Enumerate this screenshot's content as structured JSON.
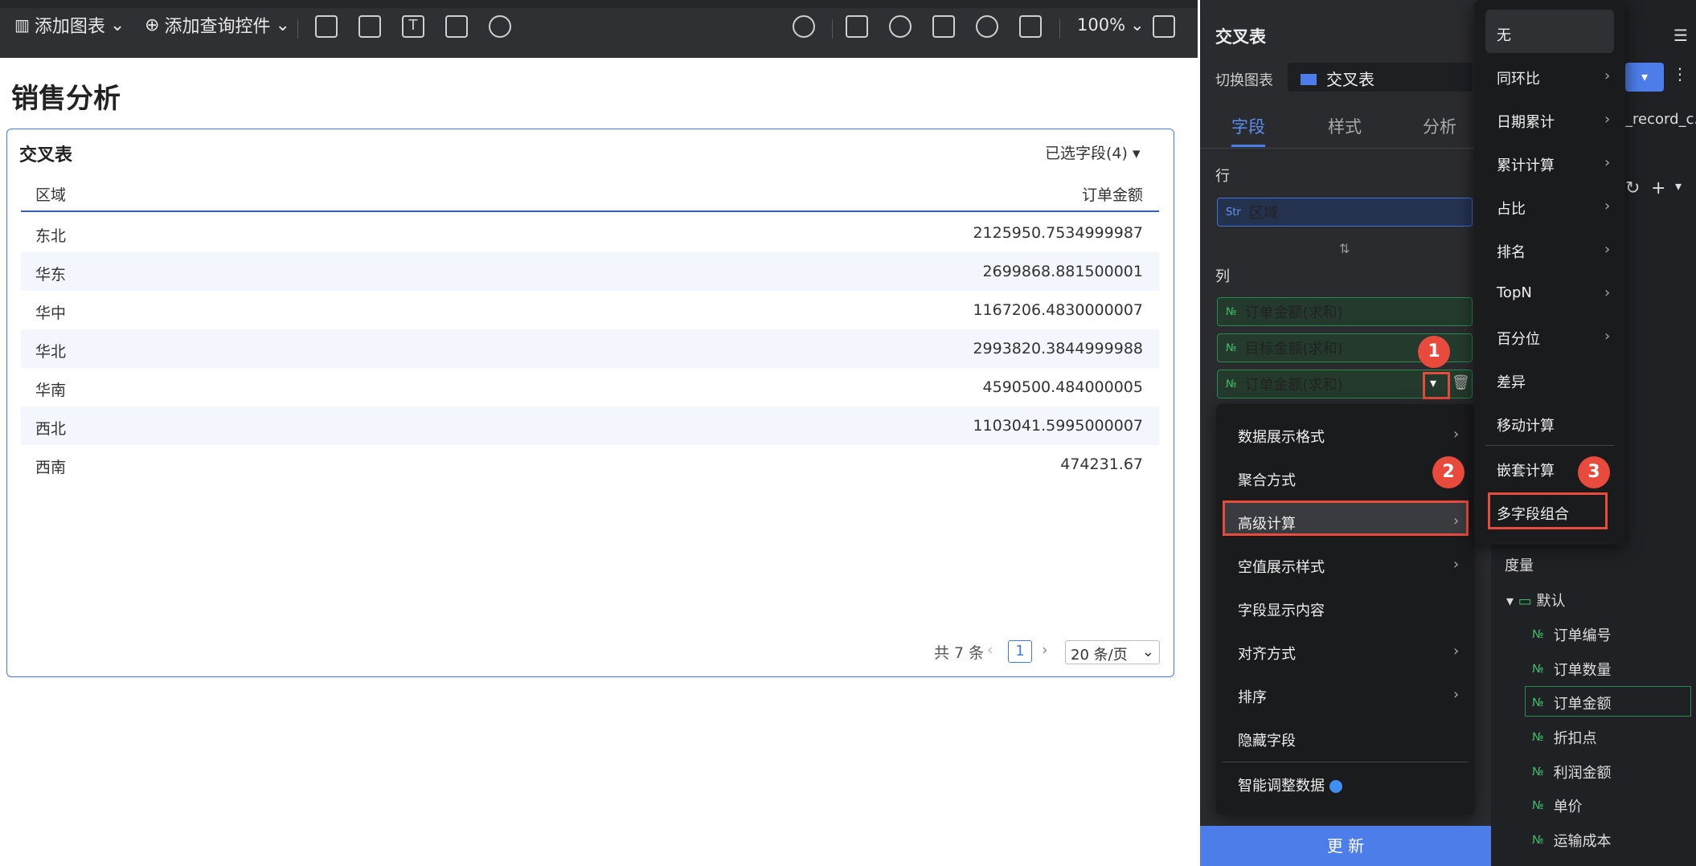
{
  "toolbar": {
    "add_chart": "添加图表",
    "add_query": "添加查询控件",
    "zoom": "100%"
  },
  "page": {
    "title": "销售分析"
  },
  "table": {
    "title": "交叉表",
    "selected_fields": "已选字段(4)",
    "col_region": "区域",
    "col_amount": "订单金额",
    "rows": [
      {
        "region": "东北",
        "amount": "2125950.7534999987"
      },
      {
        "region": "华东",
        "amount": "2699868.881500001"
      },
      {
        "region": "华中",
        "amount": "1167206.4830000007"
      },
      {
        "region": "华北",
        "amount": "2993820.3844999988"
      },
      {
        "region": "华南",
        "amount": "4590500.484000005"
      },
      {
        "region": "西北",
        "amount": "1103041.5995000007"
      },
      {
        "region": "西南",
        "amount": "474231.67"
      }
    ],
    "total": "共 7 条",
    "page": "1",
    "page_size": "20 条/页"
  },
  "panel": {
    "title": "交叉表",
    "switch_label": "切换图表",
    "chart_type": "交叉表",
    "tabs": [
      "字段",
      "样式",
      "分析"
    ],
    "row_label": "行",
    "col_label": "列",
    "row_field": "区域",
    "row_field_tag": "Str",
    "col_fields": [
      "订单金额(求和)",
      "目标金额(求和)",
      "订单金额(求和)"
    ],
    "num_tag": "№",
    "update": "更 新"
  },
  "menu": [
    "数据展示格式",
    "聚合方式",
    "高级计算",
    "空值展示样式",
    "字段显示内容",
    "对齐方式",
    "排序",
    "隐藏字段",
    "智能调整数据"
  ],
  "submenu": [
    "无",
    "同环比",
    "日期累计",
    "累计计算",
    "占比",
    "排名",
    "TopN",
    "百分位",
    "差异",
    "移动计算",
    "嵌套计算",
    "多字段组合"
  ],
  "badges": [
    "1",
    "2",
    "3"
  ],
  "fields": {
    "dataset": "_record_c...",
    "measure": "度量",
    "folder": "默认",
    "items": [
      "订单编号",
      "订单数量",
      "订单金额",
      "折扣点",
      "利润金额",
      "单价",
      "运输成本"
    ]
  }
}
